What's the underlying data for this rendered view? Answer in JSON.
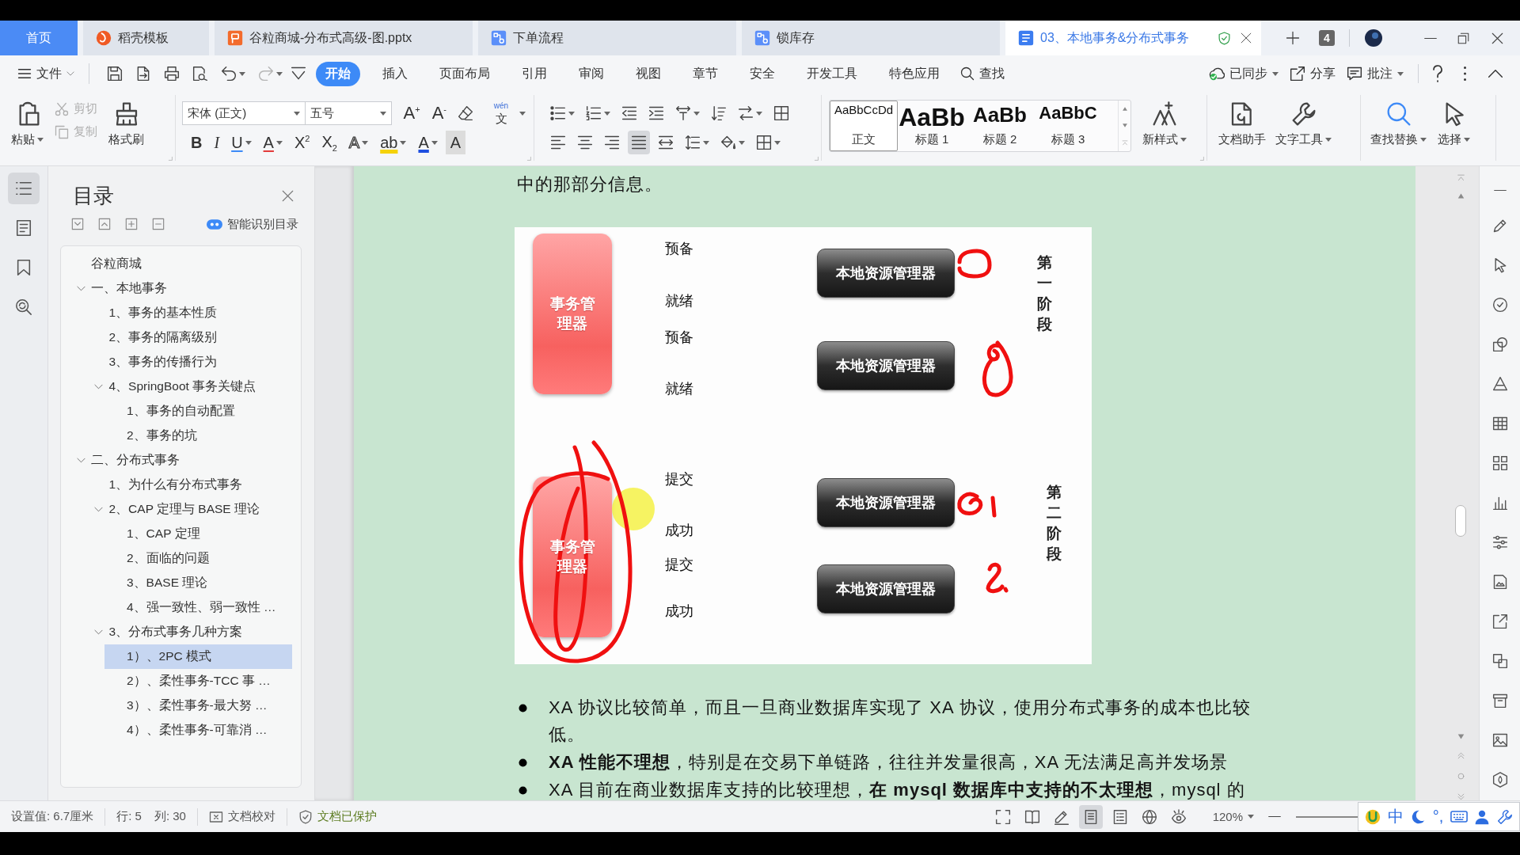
{
  "tab_bar": {
    "tabs": [
      {
        "label": "首页",
        "kind": "home",
        "selected": false
      },
      {
        "label": "稻壳模板",
        "kind": "docer",
        "selected": false
      },
      {
        "label": "谷粒商城-分布式高级-图.pptx",
        "kind": "slides",
        "selected": false
      },
      {
        "label": "下单流程",
        "kind": "flow",
        "selected": false
      },
      {
        "label": "锁库存",
        "kind": "flow",
        "selected": false
      },
      {
        "label": "03、本地事务&分布式事务",
        "kind": "writer",
        "selected": true
      }
    ],
    "window_count": "4"
  },
  "menu_bar": {
    "file": "文件",
    "tabs": [
      {
        "label": "开始",
        "selected": true
      },
      {
        "label": "插入",
        "selected": false
      },
      {
        "label": "页面布局",
        "selected": false
      },
      {
        "label": "引用",
        "selected": false
      },
      {
        "label": "审阅",
        "selected": false
      },
      {
        "label": "视图",
        "selected": false
      },
      {
        "label": "章节",
        "selected": false
      },
      {
        "label": "安全",
        "selected": false
      },
      {
        "label": "开发工具",
        "selected": false
      },
      {
        "label": "特色应用",
        "selected": false
      }
    ],
    "search": "查找",
    "actions": [
      {
        "label": "已同步",
        "kind": "sync",
        "menu": true
      },
      {
        "label": "分享",
        "kind": "share",
        "menu": false
      },
      {
        "label": "批注",
        "kind": "comment",
        "menu": true
      }
    ]
  },
  "ribbon": {
    "clipboard": [
      {
        "label": "粘贴",
        "kind": "paste",
        "menu": true,
        "disabled": false
      },
      {
        "label": "剪切",
        "kind": "cut",
        "menu": false,
        "disabled": true
      },
      {
        "label": "复制",
        "kind": "copy",
        "menu": false,
        "disabled": true
      },
      {
        "label": "格式刷",
        "kind": "painter",
        "menu": false,
        "disabled": false
      }
    ],
    "font_name": "宋体 (正文)",
    "font_size": "五号",
    "font_tools": [
      {
        "kind": "grow",
        "glyph": "A$^{+}$",
        "menu": false
      },
      {
        "kind": "shrink",
        "glyph": "A$^{-}$",
        "menu": false
      },
      {
        "kind": "pinyin",
        "glyph": "文",
        "ruby": "wén",
        "menu": true
      }
    ],
    "format_tools": [
      {
        "kind": "bold",
        "glyph": "B",
        "menu": false
      },
      {
        "kind": "italic",
        "glyph": "I",
        "menu": false
      },
      {
        "kind": "underline",
        "glyph": "U",
        "menu": true
      },
      {
        "kind": "strike",
        "glyph": "A",
        "menu": true
      },
      {
        "kind": "superscript",
        "glyph": "X$^{2}$",
        "menu": false
      },
      {
        "kind": "subscript",
        "glyph": "X$_{2}$",
        "menu": false
      },
      {
        "kind": "effect",
        "glyph": "A",
        "menu": true
      },
      {
        "kind": "highlight",
        "glyph": "ab",
        "menu": true
      },
      {
        "kind": "color",
        "glyph": "A",
        "menu": true
      },
      {
        "kind": "shading",
        "glyph": "A",
        "menu": false
      }
    ],
    "alignment": [
      {
        "kind": "left",
        "selected": false
      },
      {
        "kind": "center",
        "selected": false
      },
      {
        "kind": "right",
        "selected": false
      },
      {
        "kind": "justify",
        "selected": true
      },
      {
        "kind": "distributed",
        "selected": false
      }
    ],
    "styles": [
      {
        "sample": "AaBbCcDd",
        "label": "正文",
        "kind": "body",
        "selected": true
      },
      {
        "sample": "AaBb",
        "label": "标题 1",
        "kind": "h1",
        "selected": false
      },
      {
        "sample": "AaBb",
        "label": "标题 2",
        "kind": "h2",
        "selected": false
      },
      {
        "sample": "AaBbC",
        "label": "标题 3",
        "kind": "h3",
        "selected": false
      }
    ],
    "tools": [
      {
        "label": "新样式",
        "kind": "new-style",
        "menu": true
      },
      {
        "label": "文档助手",
        "kind": "assistant",
        "menu": false
      },
      {
        "label": "文字工具",
        "kind": "text-tools",
        "menu": true
      },
      {
        "label": "查找替换",
        "kind": "find",
        "menu": true
      },
      {
        "label": "选择",
        "kind": "select",
        "menu": true
      }
    ]
  },
  "nav_rail": [
    {
      "kind": "toc",
      "selected": true
    },
    {
      "kind": "pages",
      "selected": false
    },
    {
      "kind": "bookmarks",
      "selected": false
    },
    {
      "kind": "find",
      "selected": false
    }
  ],
  "toc_panel": {
    "title": "目录",
    "smart_toc": "智能识别目录",
    "items": [
      {
        "label": "谷粒商城",
        "selected": false
      },
      {
        "label": "一、本地事务",
        "selected": false,
        "expanded": true,
        "children": [
          {
            "label": "1、事务的基本性质",
            "selected": false
          },
          {
            "label": "2、事务的隔离级别",
            "selected": false
          },
          {
            "label": "3、事务的传播行为",
            "selected": false
          },
          {
            "label": "4、SpringBoot 事务关键点",
            "selected": false,
            "expanded": true,
            "children": [
              {
                "label": "1、事务的自动配置",
                "selected": false
              },
              {
                "label": "2、事务的坑",
                "selected": false
              }
            ]
          }
        ]
      },
      {
        "label": "二、分布式事务",
        "selected": false,
        "expanded": true,
        "children": [
          {
            "label": "1、为什么有分布式事务",
            "selected": false
          },
          {
            "label": "2、CAP 定理与 BASE 理论",
            "selected": false,
            "expanded": true,
            "children": [
              {
                "label": "1、CAP 定理",
                "selected": false
              },
              {
                "label": "2、面临的问题",
                "selected": false
              },
              {
                "label": "3、BASE 理论",
                "selected": false
              },
              {
                "label": "4、强一致性、弱一致性 …",
                "selected": false
              }
            ]
          },
          {
            "label": "3、分布式事务几种方案",
            "selected": false,
            "expanded": true,
            "children": [
              {
                "label": "1）、2PC 模式",
                "selected": true
              },
              {
                "label": "2）、柔性事务-TCC 事 …",
                "selected": false
              },
              {
                "label": "3）、柔性事务-最大努 …",
                "selected": false
              },
              {
                "label": "4）、柔性事务-可靠消 …",
                "selected": false
              }
            ]
          }
        ]
      }
    ]
  },
  "document": {
    "paragraph": "中的那部分信息。",
    "figure": {
      "phases": [
        {
          "label": "第一阶段",
          "coordinator": "事务管理器",
          "participants": [
            {
              "label": "本地资源管理器",
              "request": "预备",
              "reply": "就绪"
            },
            {
              "label": "本地资源管理器",
              "request": "预备",
              "reply": "就绪"
            }
          ]
        },
        {
          "label": "第二阶段",
          "coordinator": "事务管理器",
          "participants": [
            {
              "label": "本地资源管理器",
              "request": "提交",
              "reply": "成功"
            },
            {
              "label": "本地资源管理器",
              "request": "提交",
              "reply": "成功"
            }
          ]
        }
      ]
    },
    "bullets": [
      "XA 协议比较简单，而且一旦商业数据库实现了 XA 协议，使用分布式事务的成本也比较低。",
      "**XA 性能不理想**，特别是在交易下单链路，往往并发量很高，XA 无法满足高并发场景",
      "XA 目前在商业数据库支持的比较理想，**在 mysql 数据库中支持的不太理想**，mysql 的"
    ]
  },
  "status_bar": {
    "items": [
      {
        "text": "设置值: 6.7厘米",
        "kind": "text"
      },
      {
        "text": "行: 5",
        "kind": "text"
      },
      {
        "text": "列: 30",
        "kind": "column"
      },
      {
        "text": "文档校对",
        "kind": "proofread"
      },
      {
        "text": "文档已保护",
        "kind": "protected"
      }
    ],
    "views": [
      {
        "kind": "fullscreen",
        "selected": false
      },
      {
        "kind": "reading",
        "selected": false
      },
      {
        "kind": "edit",
        "selected": false
      },
      {
        "kind": "page",
        "selected": true
      },
      {
        "kind": "outline",
        "selected": false
      },
      {
        "kind": "web",
        "selected": false
      },
      {
        "kind": "eye",
        "selected": false
      }
    ],
    "zoom": "120%"
  },
  "ime_bar": {
    "mode": "中",
    "punctuation": "°,"
  }
}
